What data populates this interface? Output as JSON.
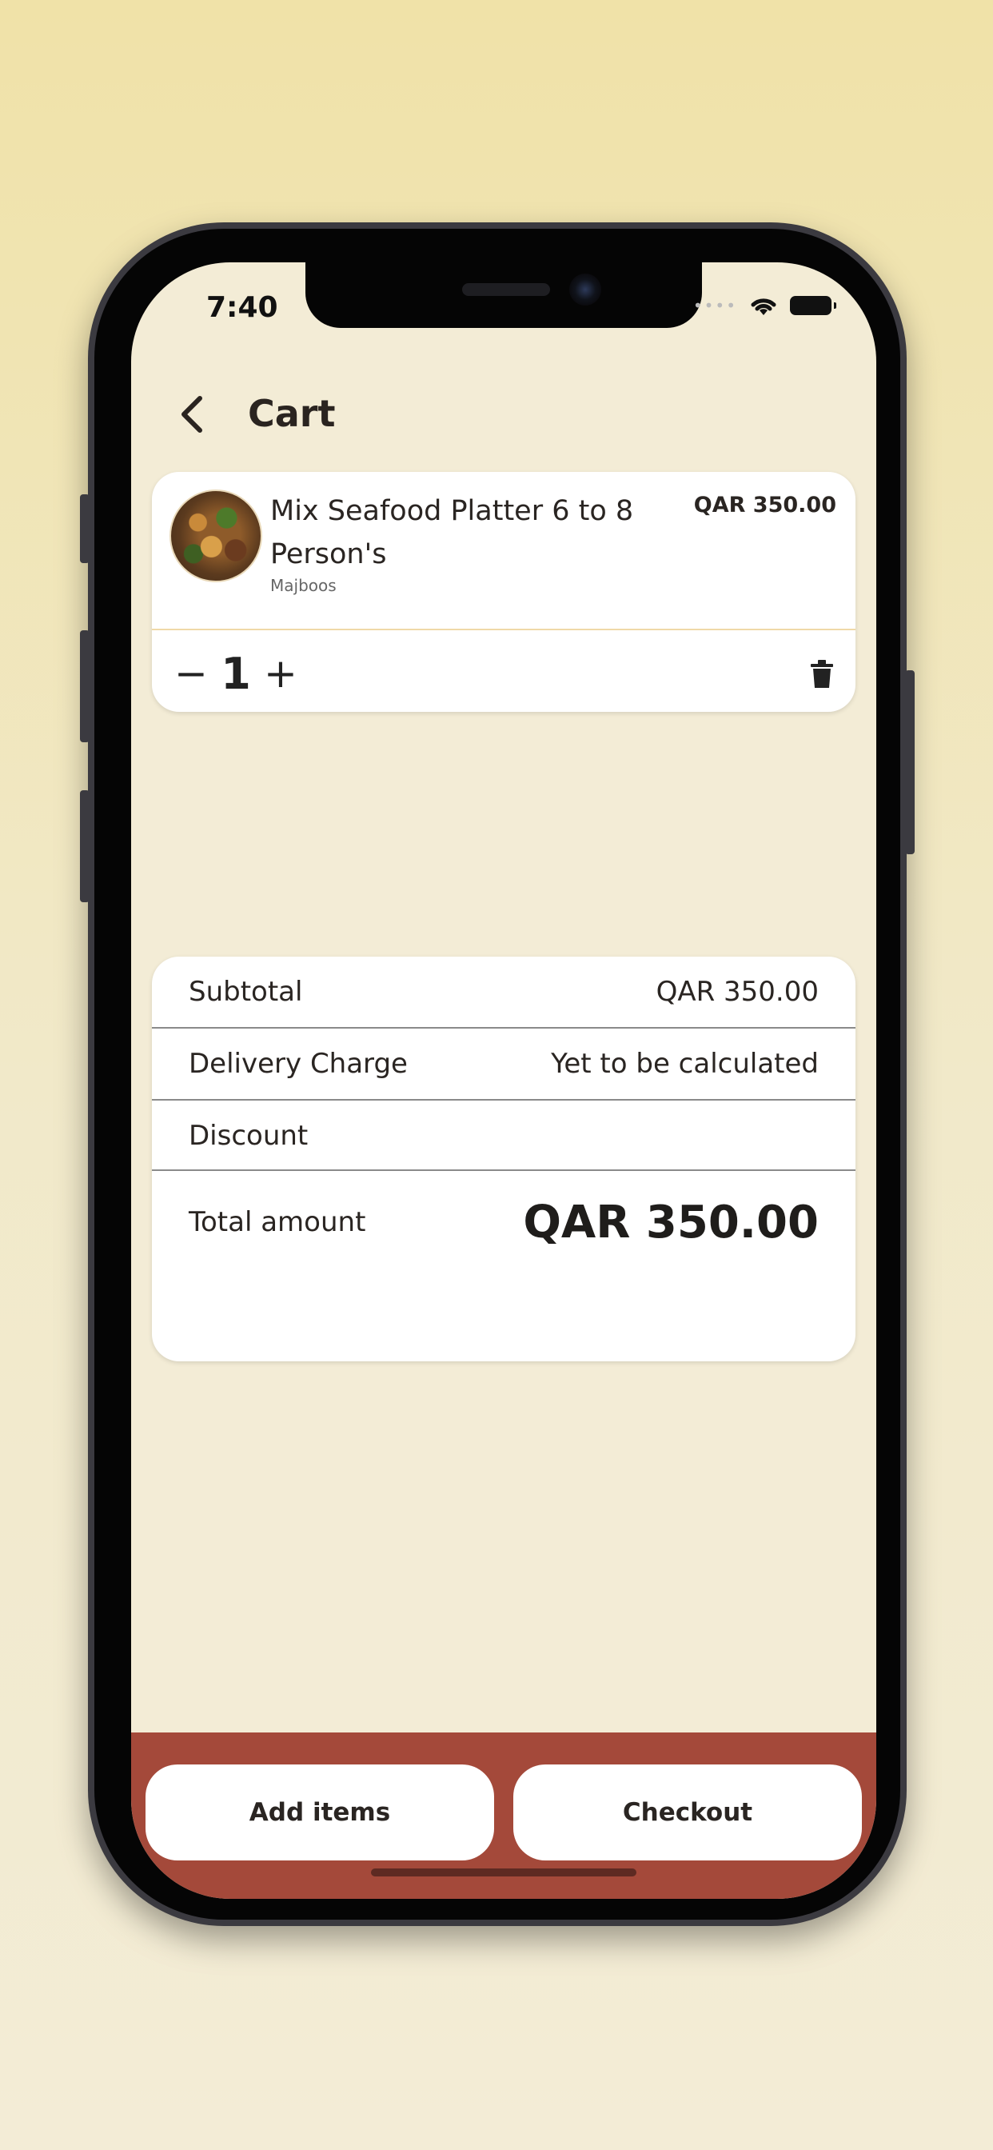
{
  "status_bar": {
    "time": "7:40"
  },
  "header": {
    "title": "Cart"
  },
  "cart_item": {
    "name": "Mix Seafood Platter 6 to 8 Person's",
    "restaurant": "Majboos",
    "price": "QAR 350.00",
    "quantity": "1",
    "minus_symbol": "−",
    "plus_symbol": "+"
  },
  "summary": {
    "subtotal_label": "Subtotal",
    "subtotal_value": "QAR 350.00",
    "delivery_label": "Delivery Charge",
    "delivery_value": "Yet to be calculated",
    "discount_label": "Discount",
    "total_label": "Total amount",
    "total_value": "QAR 350.00"
  },
  "actions": {
    "add_items_label": "Add items",
    "checkout_label": "Checkout"
  },
  "colors": {
    "background": "#f0e2a8",
    "screen": "#f3ecd6",
    "bottom_bar": "#a4493a",
    "divider_accent": "#f0d9a8"
  },
  "icons": [
    "back-arrow-icon",
    "wifi-icon",
    "battery-icon",
    "trash-icon"
  ]
}
